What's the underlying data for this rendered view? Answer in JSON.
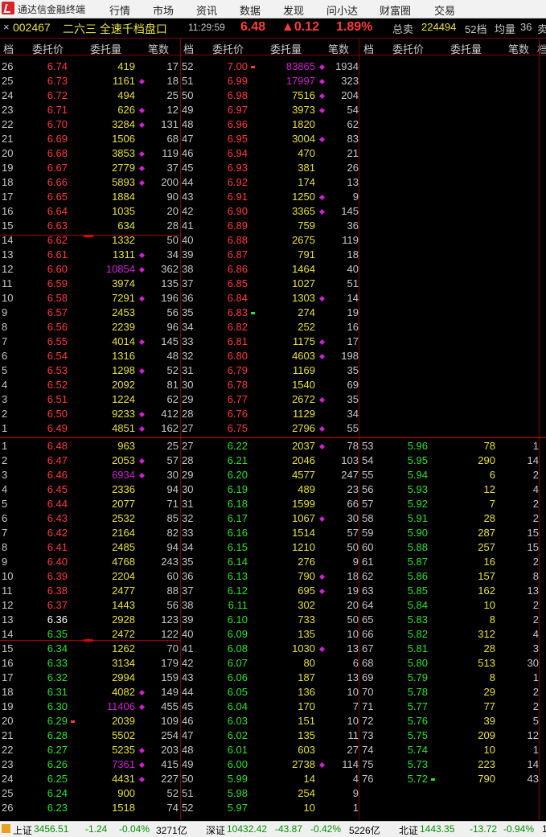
{
  "app": {
    "title": "通达信金融终端"
  },
  "menu": [
    "行情",
    "市场",
    "资讯",
    "数据",
    "发现",
    "问小达",
    "财富圈",
    "交易"
  ],
  "info": {
    "close_glyph": "×",
    "code": "002467",
    "name": "二六三 全速千档盘口",
    "time": "11:29:59",
    "price": "6.48",
    "change": "▲0.12",
    "pct": "1.89%",
    "total_sell_label": "总卖",
    "total_sell": "224494",
    "levels": "52档",
    "avg_label": "均量",
    "avg": "36",
    "more": "卖"
  },
  "headers": {
    "col1": "档",
    "col2": "委托价",
    "col3": "委托量",
    "col4": "笔数"
  },
  "colors": {
    "up": "#ff3c3c",
    "down": "#30e030",
    "flat": "#ffffff",
    "vol": "#e8e040",
    "big": "#d020d0",
    "border": "#800000",
    "menu_bg": "#f2f2f2"
  },
  "sell": {
    "cols": [
      [
        {
          "i": "26",
          "p": "6.74",
          "v": "419",
          "c": "17"
        },
        {
          "i": "25",
          "p": "6.73",
          "v": "1161",
          "c": "18",
          "d": 1
        },
        {
          "i": "24",
          "p": "6.72",
          "v": "494",
          "c": "25"
        },
        {
          "i": "23",
          "p": "6.71",
          "v": "626",
          "c": "12",
          "d": 1
        },
        {
          "i": "22",
          "p": "6.70",
          "v": "3284",
          "c": "131",
          "d": 1
        },
        {
          "i": "21",
          "p": "6.69",
          "v": "1506",
          "c": "68"
        },
        {
          "i": "20",
          "p": "6.68",
          "v": "3853",
          "c": "119",
          "d": 1
        },
        {
          "i": "19",
          "p": "6.67",
          "v": "2779",
          "c": "37",
          "d": 1
        },
        {
          "i": "18",
          "p": "6.66",
          "v": "5893",
          "c": "200",
          "d": 1
        },
        {
          "i": "17",
          "p": "6.65",
          "v": "1884",
          "c": "90"
        },
        {
          "i": "16",
          "p": "6.64",
          "v": "1035",
          "c": "20"
        },
        {
          "i": "15",
          "p": "6.63",
          "v": "634",
          "c": "28"
        },
        {
          "i": "14",
          "p": "6.62",
          "v": "1332",
          "c": "50"
        },
        {
          "i": "13",
          "p": "6.61",
          "v": "1311",
          "c": "34",
          "d": 1
        },
        {
          "i": "12",
          "p": "6.60",
          "v": "10854",
          "c": "362",
          "d": 1,
          "big": 1
        },
        {
          "i": "11",
          "p": "6.59",
          "v": "3974",
          "c": "135"
        },
        {
          "i": "10",
          "p": "6.58",
          "v": "7291",
          "c": "196",
          "d": 1
        },
        {
          "i": "9",
          "p": "6.57",
          "v": "2453",
          "c": "56"
        },
        {
          "i": "8",
          "p": "6.56",
          "v": "2239",
          "c": "96"
        },
        {
          "i": "7",
          "p": "6.55",
          "v": "4014",
          "c": "145",
          "d": 1
        },
        {
          "i": "6",
          "p": "6.54",
          "v": "1316",
          "c": "48"
        },
        {
          "i": "5",
          "p": "6.53",
          "v": "1298",
          "c": "52",
          "d": 1
        },
        {
          "i": "4",
          "p": "6.52",
          "v": "2092",
          "c": "81"
        },
        {
          "i": "3",
          "p": "6.51",
          "v": "1224",
          "c": "62"
        },
        {
          "i": "2",
          "p": "6.50",
          "v": "9233",
          "c": "412",
          "d": 1
        },
        {
          "i": "1",
          "p": "6.49",
          "v": "4851",
          "c": "162",
          "d": 1
        }
      ],
      [
        {
          "i": "52",
          "p": "7.00",
          "v": "83865",
          "c": "1934",
          "d": 1,
          "big": 1,
          "pm": "r"
        },
        {
          "i": "51",
          "p": "6.99",
          "v": "17997",
          "c": "323",
          "d": 1,
          "big": 1
        },
        {
          "i": "50",
          "p": "6.98",
          "v": "7516",
          "c": "204",
          "d": 1
        },
        {
          "i": "49",
          "p": "6.97",
          "v": "3973",
          "c": "54",
          "d": 1
        },
        {
          "i": "48",
          "p": "6.96",
          "v": "1820",
          "c": "62"
        },
        {
          "i": "47",
          "p": "6.95",
          "v": "3004",
          "c": "83",
          "d": 1
        },
        {
          "i": "46",
          "p": "6.94",
          "v": "470",
          "c": "21"
        },
        {
          "i": "45",
          "p": "6.93",
          "v": "381",
          "c": "26"
        },
        {
          "i": "44",
          "p": "6.92",
          "v": "174",
          "c": "13"
        },
        {
          "i": "43",
          "p": "6.91",
          "v": "1250",
          "c": "9",
          "d": 1
        },
        {
          "i": "42",
          "p": "6.90",
          "v": "3365",
          "c": "145",
          "d": 1
        },
        {
          "i": "41",
          "p": "6.89",
          "v": "759",
          "c": "36"
        },
        {
          "i": "40",
          "p": "6.88",
          "v": "2675",
          "c": "119"
        },
        {
          "i": "39",
          "p": "6.87",
          "v": "791",
          "c": "18"
        },
        {
          "i": "38",
          "p": "6.86",
          "v": "1464",
          "c": "40"
        },
        {
          "i": "37",
          "p": "6.85",
          "v": "1027",
          "c": "51"
        },
        {
          "i": "36",
          "p": "6.84",
          "v": "1303",
          "c": "14",
          "d": 1
        },
        {
          "i": "35",
          "p": "6.83",
          "v": "274",
          "c": "19",
          "pm": "g"
        },
        {
          "i": "34",
          "p": "6.82",
          "v": "252",
          "c": "16"
        },
        {
          "i": "33",
          "p": "6.81",
          "v": "1175",
          "c": "17",
          "d": 1
        },
        {
          "i": "32",
          "p": "6.80",
          "v": "4603",
          "c": "198",
          "d": 1
        },
        {
          "i": "31",
          "p": "6.79",
          "v": "1169",
          "c": "35"
        },
        {
          "i": "30",
          "p": "6.78",
          "v": "1540",
          "c": "69"
        },
        {
          "i": "29",
          "p": "6.77",
          "v": "2672",
          "c": "35",
          "d": 1
        },
        {
          "i": "28",
          "p": "6.76",
          "v": "1129",
          "c": "34"
        },
        {
          "i": "27",
          "p": "6.75",
          "v": "2796",
          "c": "55",
          "d": 1
        }
      ]
    ]
  },
  "buy": {
    "cols": [
      [
        {
          "i": "1",
          "p": "6.48",
          "v": "963",
          "c": "25",
          "pc": "up"
        },
        {
          "i": "2",
          "p": "6.47",
          "v": "2053",
          "c": "57",
          "d": 1,
          "pc": "up"
        },
        {
          "i": "3",
          "p": "6.46",
          "v": "6934",
          "c": "30",
          "d": 1,
          "big": 1,
          "pc": "up"
        },
        {
          "i": "4",
          "p": "6.45",
          "v": "2336",
          "c": "94",
          "pc": "up"
        },
        {
          "i": "5",
          "p": "6.44",
          "v": "2077",
          "c": "71",
          "pc": "up"
        },
        {
          "i": "6",
          "p": "6.43",
          "v": "2532",
          "c": "85",
          "pc": "up"
        },
        {
          "i": "7",
          "p": "6.42",
          "v": "2164",
          "c": "82",
          "pc": "up"
        },
        {
          "i": "8",
          "p": "6.41",
          "v": "2485",
          "c": "94",
          "pc": "up"
        },
        {
          "i": "9",
          "p": "6.40",
          "v": "4768",
          "c": "243",
          "pc": "up"
        },
        {
          "i": "10",
          "p": "6.39",
          "v": "2204",
          "c": "60",
          "pc": "up"
        },
        {
          "i": "11",
          "p": "6.38",
          "v": "2477",
          "c": "88",
          "pc": "up"
        },
        {
          "i": "12",
          "p": "6.37",
          "v": "1443",
          "c": "56",
          "pc": "up"
        },
        {
          "i": "13",
          "p": "6.36",
          "v": "2928",
          "c": "123",
          "pc": "flat"
        },
        {
          "i": "14",
          "p": "6.35",
          "v": "2472",
          "c": "122",
          "pc": "down"
        },
        {
          "i": "15",
          "p": "6.34",
          "v": "1262",
          "c": "70",
          "pc": "down"
        },
        {
          "i": "16",
          "p": "6.33",
          "v": "3134",
          "c": "179",
          "pc": "down"
        },
        {
          "i": "17",
          "p": "6.32",
          "v": "2994",
          "c": "159",
          "pc": "down"
        },
        {
          "i": "18",
          "p": "6.31",
          "v": "4082",
          "c": "149",
          "d": 1,
          "pc": "down"
        },
        {
          "i": "19",
          "p": "6.30",
          "v": "11406",
          "c": "455",
          "d": 1,
          "big": 1,
          "pc": "down"
        },
        {
          "i": "20",
          "p": "6.29",
          "v": "2039",
          "c": "109",
          "pc": "down",
          "pm": "r"
        },
        {
          "i": "21",
          "p": "6.28",
          "v": "5502",
          "c": "254",
          "pc": "down"
        },
        {
          "i": "22",
          "p": "6.27",
          "v": "5235",
          "c": "203",
          "d": 1,
          "pc": "down"
        },
        {
          "i": "23",
          "p": "6.26",
          "v": "7361",
          "c": "415",
          "d": 1,
          "big": 1,
          "pc": "down"
        },
        {
          "i": "24",
          "p": "6.25",
          "v": "4431",
          "c": "227",
          "d": 1,
          "pc": "down"
        },
        {
          "i": "25",
          "p": "6.24",
          "v": "900",
          "c": "52",
          "pc": "down"
        },
        {
          "i": "26",
          "p": "6.23",
          "v": "1518",
          "c": "74",
          "pc": "down"
        }
      ],
      [
        {
          "i": "27",
          "p": "6.22",
          "v": "2037",
          "c": "78",
          "d": 1,
          "pc": "down"
        },
        {
          "i": "28",
          "p": "6.21",
          "v": "2046",
          "c": "103",
          "pc": "down"
        },
        {
          "i": "29",
          "p": "6.20",
          "v": "4577",
          "c": "247",
          "pc": "down"
        },
        {
          "i": "30",
          "p": "6.19",
          "v": "489",
          "c": "23",
          "pc": "down"
        },
        {
          "i": "31",
          "p": "6.18",
          "v": "1599",
          "c": "66",
          "pc": "down"
        },
        {
          "i": "32",
          "p": "6.17",
          "v": "1067",
          "c": "30",
          "d": 1,
          "pc": "down"
        },
        {
          "i": "33",
          "p": "6.16",
          "v": "1514",
          "c": "57",
          "pc": "down"
        },
        {
          "i": "34",
          "p": "6.15",
          "v": "1210",
          "c": "50",
          "pc": "down"
        },
        {
          "i": "35",
          "p": "6.14",
          "v": "276",
          "c": "9",
          "pc": "down"
        },
        {
          "i": "36",
          "p": "6.13",
          "v": "790",
          "c": "18",
          "d": 1,
          "pc": "down"
        },
        {
          "i": "37",
          "p": "6.12",
          "v": "695",
          "c": "19",
          "d": 1,
          "pc": "down"
        },
        {
          "i": "38",
          "p": "6.11",
          "v": "302",
          "c": "20",
          "pc": "down"
        },
        {
          "i": "39",
          "p": "6.10",
          "v": "733",
          "c": "50",
          "pc": "down"
        },
        {
          "i": "40",
          "p": "6.09",
          "v": "135",
          "c": "10",
          "pc": "down"
        },
        {
          "i": "41",
          "p": "6.08",
          "v": "1030",
          "c": "13",
          "d": 1,
          "pc": "down"
        },
        {
          "i": "42",
          "p": "6.07",
          "v": "80",
          "c": "6",
          "pc": "down"
        },
        {
          "i": "43",
          "p": "6.06",
          "v": "187",
          "c": "13",
          "pc": "down"
        },
        {
          "i": "44",
          "p": "6.05",
          "v": "136",
          "c": "10",
          "pc": "down"
        },
        {
          "i": "45",
          "p": "6.04",
          "v": "170",
          "c": "7",
          "pc": "down"
        },
        {
          "i": "46",
          "p": "6.03",
          "v": "151",
          "c": "10",
          "pc": "down"
        },
        {
          "i": "47",
          "p": "6.02",
          "v": "135",
          "c": "11",
          "pc": "down"
        },
        {
          "i": "48",
          "p": "6.01",
          "v": "603",
          "c": "27",
          "pc": "down"
        },
        {
          "i": "49",
          "p": "6.00",
          "v": "2738",
          "c": "114",
          "d": 1,
          "pc": "down"
        },
        {
          "i": "50",
          "p": "5.99",
          "v": "14",
          "c": "4",
          "pc": "down"
        },
        {
          "i": "51",
          "p": "5.98",
          "v": "254",
          "c": "9",
          "pc": "down"
        },
        {
          "i": "52",
          "p": "5.97",
          "v": "10",
          "c": "1",
          "pc": "down"
        }
      ],
      [
        {
          "i": "53",
          "p": "5.96",
          "v": "78",
          "c": "1",
          "pc": "down"
        },
        {
          "i": "54",
          "p": "5.95",
          "v": "290",
          "c": "14",
          "pc": "down"
        },
        {
          "i": "55",
          "p": "5.94",
          "v": "6",
          "c": "2",
          "pc": "down"
        },
        {
          "i": "56",
          "p": "5.93",
          "v": "12",
          "c": "4",
          "pc": "down"
        },
        {
          "i": "57",
          "p": "5.92",
          "v": "7",
          "c": "2",
          "pc": "down"
        },
        {
          "i": "58",
          "p": "5.91",
          "v": "28",
          "c": "2",
          "pc": "down"
        },
        {
          "i": "59",
          "p": "5.90",
          "v": "287",
          "c": "15",
          "pc": "down"
        },
        {
          "i": "60",
          "p": "5.88",
          "v": "257",
          "c": "15",
          "pc": "down"
        },
        {
          "i": "61",
          "p": "5.87",
          "v": "16",
          "c": "2",
          "pc": "down"
        },
        {
          "i": "62",
          "p": "5.86",
          "v": "157",
          "c": "8",
          "pc": "down"
        },
        {
          "i": "63",
          "p": "5.85",
          "v": "162",
          "c": "13",
          "pc": "down"
        },
        {
          "i": "64",
          "p": "5.84",
          "v": "10",
          "c": "2",
          "pc": "down"
        },
        {
          "i": "65",
          "p": "5.83",
          "v": "8",
          "c": "2",
          "pc": "down"
        },
        {
          "i": "66",
          "p": "5.82",
          "v": "312",
          "c": "4",
          "pc": "down"
        },
        {
          "i": "67",
          "p": "5.81",
          "v": "28",
          "c": "3",
          "pc": "down"
        },
        {
          "i": "68",
          "p": "5.80",
          "v": "513",
          "c": "30",
          "pc": "down"
        },
        {
          "i": "69",
          "p": "5.79",
          "v": "8",
          "c": "1",
          "pc": "down"
        },
        {
          "i": "70",
          "p": "5.78",
          "v": "29",
          "c": "2",
          "pc": "down"
        },
        {
          "i": "71",
          "p": "5.77",
          "v": "77",
          "c": "2",
          "pc": "down"
        },
        {
          "i": "72",
          "p": "5.76",
          "v": "39",
          "c": "5",
          "pc": "down"
        },
        {
          "i": "73",
          "p": "5.75",
          "v": "209",
          "c": "12",
          "pc": "down"
        },
        {
          "i": "74",
          "p": "5.74",
          "v": "10",
          "c": "1",
          "pc": "down"
        },
        {
          "i": "75",
          "p": "5.73",
          "v": "223",
          "c": "14",
          "pc": "down"
        },
        {
          "i": "76",
          "p": "5.72",
          "v": "790",
          "c": "43",
          "pc": "down",
          "pm": "g"
        }
      ]
    ]
  },
  "status": {
    "sh_name": "上证",
    "sh_val": "3456.51",
    "sh_chg": "-1.24",
    "sh_pct": "-0.04%",
    "sh_amt": "3271亿",
    "sz_name": "深证",
    "sz_val": "10432.42",
    "sz_chg": "-43.87",
    "sz_pct": "-0.42%",
    "sz_amt": "5226亿",
    "bz_name": "北证",
    "bz_val": "1443.35",
    "bz_chg": "-13.72",
    "bz_pct": "-0.94%",
    "bz_more": "1"
  }
}
